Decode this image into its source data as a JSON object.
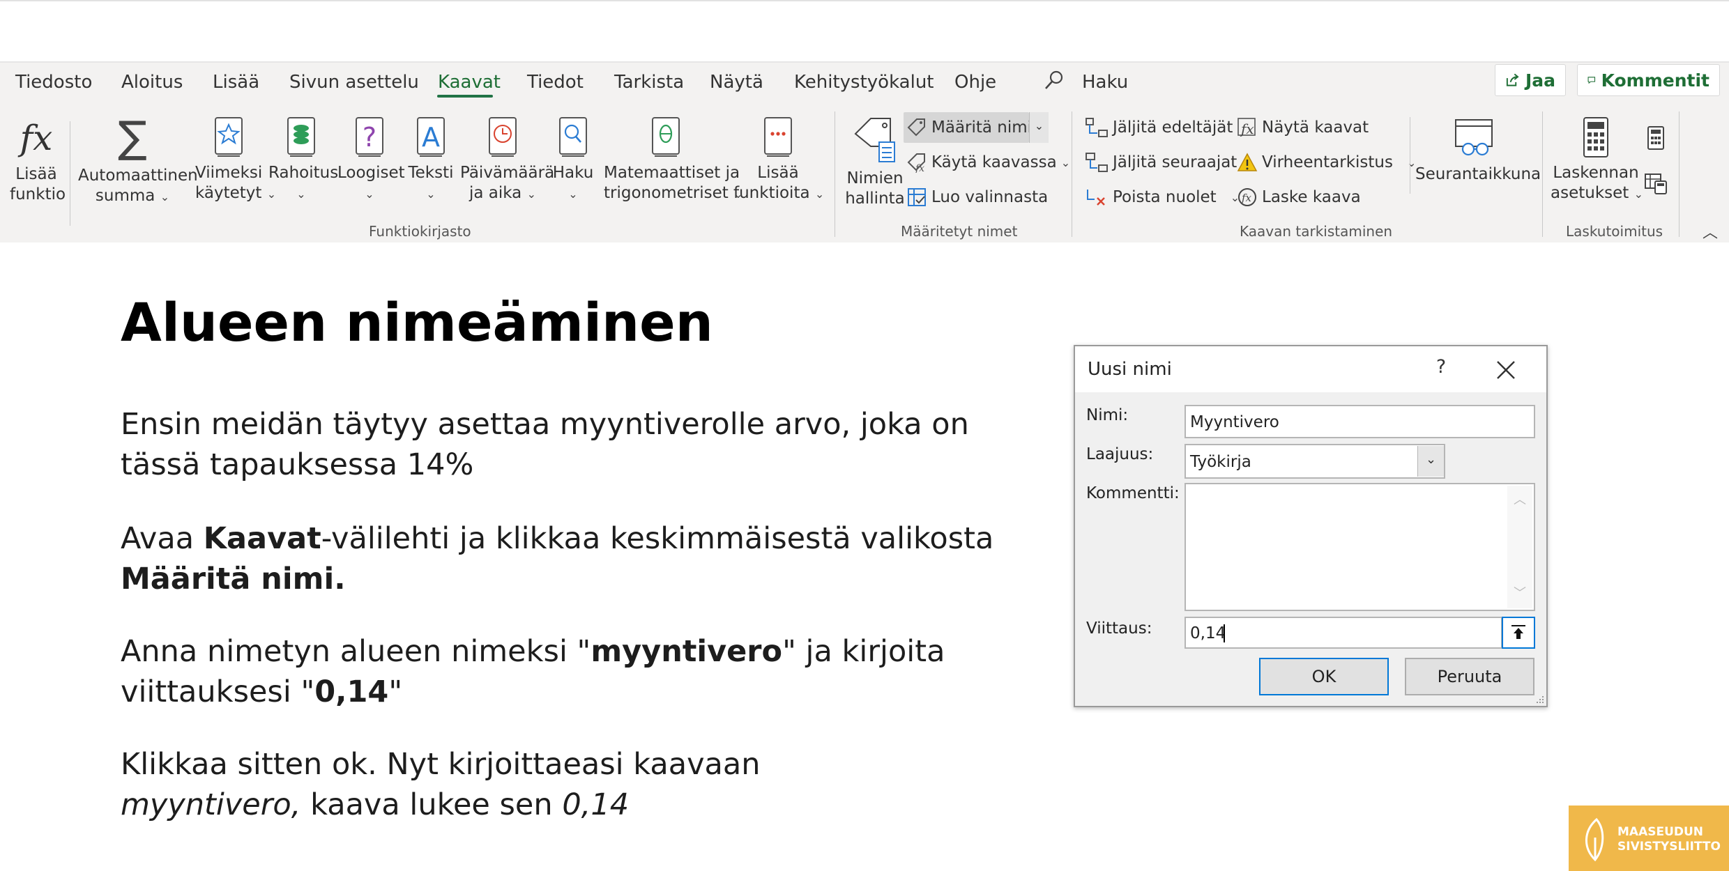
{
  "ribbon": {
    "tabs": [
      "Tiedosto",
      "Aloitus",
      "Lisää",
      "Sivun asettelu",
      "Kaavat",
      "Tiedot",
      "Tarkista",
      "Näytä",
      "Kehitystyökalut",
      "Ohje"
    ],
    "active_tab": "Kaavat",
    "search_label": "Haku",
    "share_label": "Jaa",
    "comments_label": "Kommentit",
    "function_library": {
      "group_label": "Funktiokirjasto",
      "insert_function": [
        "Lisää",
        "funktio"
      ],
      "autosum": [
        "Automaattinen",
        "summa"
      ],
      "recent": [
        "Viimeksi",
        "käytetyt"
      ],
      "financial": "Rahoitus",
      "logical": "Loogiset",
      "text": "Teksti",
      "datetime": [
        "Päivämäärä",
        "ja aika"
      ],
      "lookup": "Haku",
      "math": [
        "Matemaattiset ja",
        "trigonometriset"
      ],
      "more": [
        "Lisää",
        "funktioita"
      ]
    },
    "defined_names": {
      "group_label": "Määritetyt nimet",
      "name_manager": [
        "Nimien",
        "hallinta"
      ],
      "define_name": "Määritä nimi",
      "use_in_formula": "Käytä kaavassa",
      "create_from_selection": "Luo valinnasta"
    },
    "formula_auditing": {
      "group_label": "Kaavan tarkistaminen",
      "trace_precedents": "Jäljitä edeltäjät",
      "trace_dependents": "Jäljitä seuraajat",
      "remove_arrows": "Poista nuolet",
      "show_formulas": "Näytä kaavat",
      "error_checking": "Virheentarkistus",
      "evaluate_formula": "Laske kaava",
      "watch_window": "Seurantaikkuna"
    },
    "calculation": {
      "group_label": "Laskutoimitus",
      "options": [
        "Laskennan",
        "asetukset"
      ]
    }
  },
  "slide": {
    "title": "Alueen nimeäminen",
    "p1": [
      "Ensin meidän täytyy asettaa myyntiverolle arvo, joka on",
      "tässä tapauksessa 14%"
    ],
    "p2": {
      "a": "Avaa ",
      "b": "Kaavat",
      "c": "-välilehti ja klikkaa keskimmäisestä valikosta",
      "d": "Määritä nimi."
    },
    "p3": {
      "a": "Anna nimetyn alueen nimeksi \"",
      "b": "myyntivero",
      "c": "\" ja kirjoita",
      "d": "viittauksesi \"",
      "e": "0,14",
      "f": "\""
    },
    "p4": {
      "a": "Klikkaa sitten ok. Nyt kirjoittaeasi kaavaan",
      "b": "myyntivero,",
      "c": " kaava lukee sen ",
      "d": "0,14"
    }
  },
  "dialog": {
    "title": "Uusi nimi",
    "help": "?",
    "name_label": "Nimi:",
    "name_value": "Myyntivero",
    "scope_label": "Laajuus:",
    "scope_value": "Työkirja",
    "comment_label": "Kommentti:",
    "comment_value": "",
    "refers_label": "Viittaus:",
    "refers_value": "0,14",
    "ok": "OK",
    "cancel": "Peruuta"
  },
  "logo": {
    "line1": "MAASEUDUN",
    "line2": "SIVISTYSLIITTO"
  },
  "colors": {
    "accent": "#217346",
    "ribbon_bg": "#f3f2f1",
    "logo_bg": "#f0b84a"
  }
}
